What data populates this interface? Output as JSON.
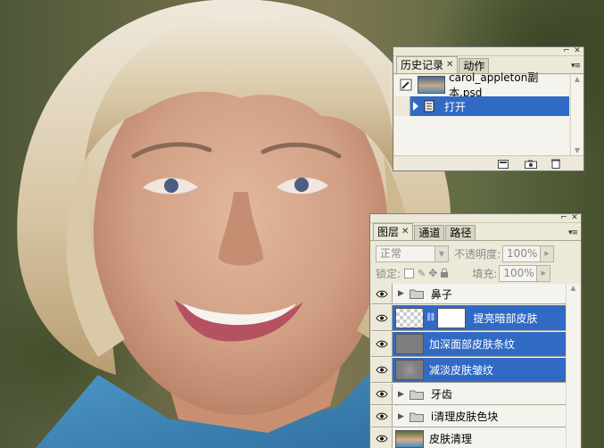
{
  "history_panel": {
    "tabs": [
      {
        "label": "历史记录",
        "active": true,
        "closable": true
      },
      {
        "label": "动作",
        "active": false,
        "closable": false
      }
    ],
    "snapshot_name": "carol_appleton副本.psd",
    "states": [
      {
        "label": "打开",
        "selected": true
      }
    ]
  },
  "layers_panel": {
    "tabs": [
      {
        "label": "图层",
        "active": true,
        "closable": true
      },
      {
        "label": "通道",
        "active": false,
        "closable": false
      },
      {
        "label": "路径",
        "active": false,
        "closable": false
      }
    ],
    "blend_mode": "正常",
    "opacity_label": "不透明度:",
    "opacity_value": "100%",
    "lock_label": "锁定:",
    "fill_label": "填充:",
    "fill_value": "100%",
    "layers": [
      {
        "name": "鼻子",
        "kind": "group",
        "selected": false
      },
      {
        "name": "提亮暗部皮肤",
        "kind": "masked",
        "selected": true
      },
      {
        "name": "加深面部皮肤条纹",
        "kind": "layer",
        "selected": true
      },
      {
        "name": "减淡皮肤皱纹",
        "kind": "layer",
        "selected": true
      },
      {
        "name": "牙齿",
        "kind": "group",
        "selected": false
      },
      {
        "name": "i清理皮肤色块",
        "kind": "group",
        "selected": false
      },
      {
        "name": "皮肤清理",
        "kind": "photo",
        "selected": false
      }
    ]
  },
  "colors": {
    "selection": "#316ac5",
    "panel_bg": "#ece9d8"
  }
}
